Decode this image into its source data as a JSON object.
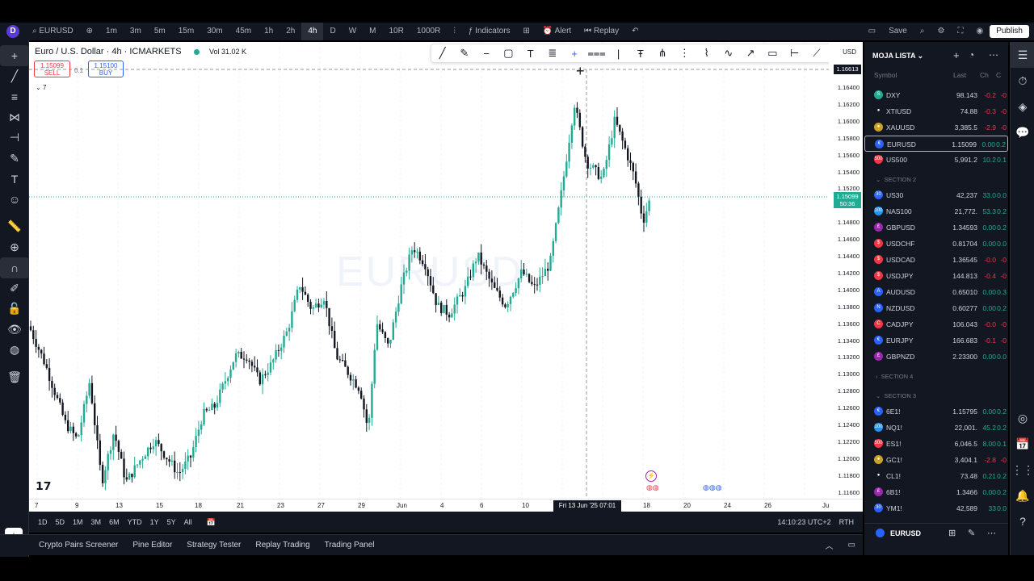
{
  "topbar": {
    "logo": "D",
    "symbol": "EURUSD",
    "intervals": [
      "1m",
      "3m",
      "5m",
      "15m",
      "30m",
      "45m",
      "1h",
      "2h",
      "4h",
      "D",
      "W",
      "M",
      "10R",
      "1000R"
    ],
    "active_interval": "4h",
    "indicators": "Indicators",
    "alert": "Alert",
    "replay": "Replay",
    "save": "Save",
    "publish": "Publish"
  },
  "chart": {
    "legend_title": "Euro / U.S. Dollar · 4h · ICMARKETS",
    "volume": "Vol 31.02 K",
    "sell_price": "1.15099",
    "sell_label": "SELL",
    "spread": "0.1",
    "buy_price": "1.15100",
    "buy_label": "BUY",
    "indicator_count": "7",
    "watermark": "EURUSD",
    "currency": "USD",
    "price_labels": [
      "1.16400",
      "1.16200",
      "1.16000",
      "1.15800",
      "1.15600",
      "1.15400",
      "1.15200",
      "1.15000",
      "1.14800",
      "1.14600",
      "1.14400",
      "1.14200",
      "1.14000",
      "1.13800",
      "1.13600",
      "1.13400",
      "1.13200",
      "1.13000",
      "1.12800",
      "1.12600",
      "1.12400",
      "1.12200",
      "1.12000",
      "1.11800",
      "1.11600"
    ],
    "crosshair_price": "1.16613",
    "current_price": "1.15099",
    "countdown": "50:36",
    "time_labels": [
      "7",
      "9",
      "13",
      "15",
      "18",
      "21",
      "23",
      "27",
      "29",
      "Jun",
      "4",
      "6",
      "10",
      "18",
      "20",
      "24",
      "26",
      "Ju"
    ],
    "cursor_time": "Fri 13 Jun '25   07:01"
  },
  "bottom": {
    "ranges": [
      "1D",
      "5D",
      "1M",
      "3M",
      "6M",
      "YTD",
      "1Y",
      "5Y",
      "All"
    ],
    "clock": "14:10:23 UTC+2",
    "session": "RTH",
    "tabs": [
      "Crypto Pairs Screener",
      "Pine Editor",
      "Strategy Tester",
      "Replay Trading",
      "Trading Panel"
    ]
  },
  "watchlist": {
    "title": "MOJA LISTA",
    "cols": {
      "symbol": "Symbol",
      "last": "Last",
      "ch": "Ch",
      "chp": "C"
    },
    "rows": [
      {
        "sym": "DXY",
        "last": "98.143",
        "chg": "-0.2",
        "chp": "-0",
        "color": "#22ab94",
        "icon": "S"
      },
      {
        "sym": "XTIUSD",
        "last": "74.88",
        "chg": "-0.3",
        "chp": "-0",
        "color": "#131722",
        "icon": "●"
      },
      {
        "sym": "XAUUSD",
        "last": "3,385.5",
        "chg": "-2.9",
        "chp": "-0",
        "color": "#c9a227",
        "icon": "●"
      },
      {
        "sym": "EURUSD",
        "last": "1.15099",
        "chg": "0.00",
        "chp": "0.2",
        "color": "#2962ff",
        "icon": "€"
      },
      {
        "sym": "US500",
        "last": "5,991.2",
        "chg": "10.2",
        "chp": "0.1",
        "color": "#f23645",
        "icon": "500"
      }
    ],
    "section2": "SECTION 2",
    "rows2": [
      {
        "sym": "US30",
        "last": "42,237",
        "chg": "33.0",
        "chp": "0.0",
        "color": "#2962ff",
        "icon": "30"
      },
      {
        "sym": "NAS100",
        "last": "21,772.",
        "chg": "53.3",
        "chp": "0.2",
        "color": "#2196f3",
        "icon": "100"
      },
      {
        "sym": "GBPUSD",
        "last": "1.34593",
        "chg": "0.00",
        "chp": "0.2",
        "color": "#9c27b0",
        "icon": "£"
      },
      {
        "sym": "USDCHF",
        "last": "0.81704",
        "chg": "0.00",
        "chp": "0.0",
        "color": "#f23645",
        "icon": "$"
      },
      {
        "sym": "USDCAD",
        "last": "1.36545",
        "chg": "-0.0",
        "chp": "-0",
        "color": "#f23645",
        "icon": "$"
      },
      {
        "sym": "USDJPY",
        "last": "144.813",
        "chg": "-0.4",
        "chp": "-0",
        "color": "#f23645",
        "icon": "$"
      },
      {
        "sym": "AUDUSD",
        "last": "0.65010",
        "chg": "0.00",
        "chp": "0.3",
        "color": "#2962ff",
        "icon": "A"
      },
      {
        "sym": "NZDUSD",
        "last": "0.60277",
        "chg": "0.00",
        "chp": "0.2",
        "color": "#2962ff",
        "icon": "N"
      },
      {
        "sym": "CADJPY",
        "last": "106.043",
        "chg": "-0.0",
        "chp": "-0",
        "color": "#f23645",
        "icon": "C"
      },
      {
        "sym": "EURJPY",
        "last": "166.683",
        "chg": "-0.1",
        "chp": "-0",
        "color": "#2962ff",
        "icon": "€"
      },
      {
        "sym": "GBPNZD",
        "last": "2.23300",
        "chg": "0.00",
        "chp": "0.0",
        "color": "#9c27b0",
        "icon": "£"
      }
    ],
    "section4": "SECTION 4",
    "section3": "SECTION 3",
    "rows3": [
      {
        "sym": "6E1!",
        "last": "1.15795",
        "chg": "0.00",
        "chp": "0.2",
        "color": "#2962ff",
        "icon": "€"
      },
      {
        "sym": "NQ1!",
        "last": "22,001.",
        "chg": "45.2",
        "chp": "0.2",
        "color": "#2196f3",
        "icon": "100"
      },
      {
        "sym": "ES1!",
        "last": "6,046.5",
        "chg": "8.00",
        "chp": "0.1",
        "color": "#f23645",
        "icon": "500"
      },
      {
        "sym": "GC1!",
        "last": "3,404.1",
        "chg": "-2.8",
        "chp": "-0",
        "color": "#c9a227",
        "icon": "●"
      },
      {
        "sym": "CL1!",
        "last": "73.48",
        "chg": "0.21",
        "chp": "0.2",
        "color": "#131722",
        "icon": "●"
      },
      {
        "sym": "6B1!",
        "last": "1.3466",
        "chg": "0.00",
        "chp": "0.2",
        "color": "#9c27b0",
        "icon": "£"
      },
      {
        "sym": "YM1!",
        "last": "42,589",
        "chg": "33",
        "chp": "0.0",
        "color": "#2962ff",
        "icon": "30"
      }
    ],
    "bottom_symbol": "EURUSD"
  },
  "colors": {
    "up": "#22ab94",
    "down": "#131722",
    "neg": "#f23645"
  }
}
